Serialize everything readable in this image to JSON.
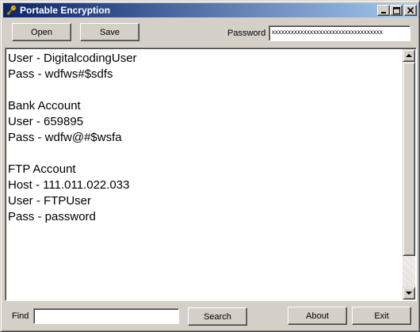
{
  "window": {
    "title": "Portable Encryption",
    "icon": "key-icon",
    "caption_buttons": {
      "minimize": "minimize-icon",
      "maximize": "maximize-icon",
      "close": "close-icon"
    }
  },
  "toolbar": {
    "open_label": "Open",
    "save_label": "Save",
    "password_label": "Password",
    "password_value": "xxxxxxxxxxxxxxxxxxxxxxxxxxxxxxxxxxx"
  },
  "editor": {
    "lines": [
      "User - DigitalcodingUser",
      "Pass - wdfws#$sdfs",
      "",
      "Bank Account",
      "User - 659895",
      "Pass - wdfw@#$wsfa",
      "",
      "FTP Account",
      "Host - 111.011.022.033",
      "User - FTPUser",
      "Pass - password"
    ]
  },
  "footer": {
    "find_label": "Find",
    "find_value": "",
    "search_label": "Search",
    "about_label": "About",
    "exit_label": "Exit"
  },
  "colors": {
    "titlebar_start": "#0a246a",
    "titlebar_end": "#a6caf0",
    "face": "#d4d0c8"
  }
}
